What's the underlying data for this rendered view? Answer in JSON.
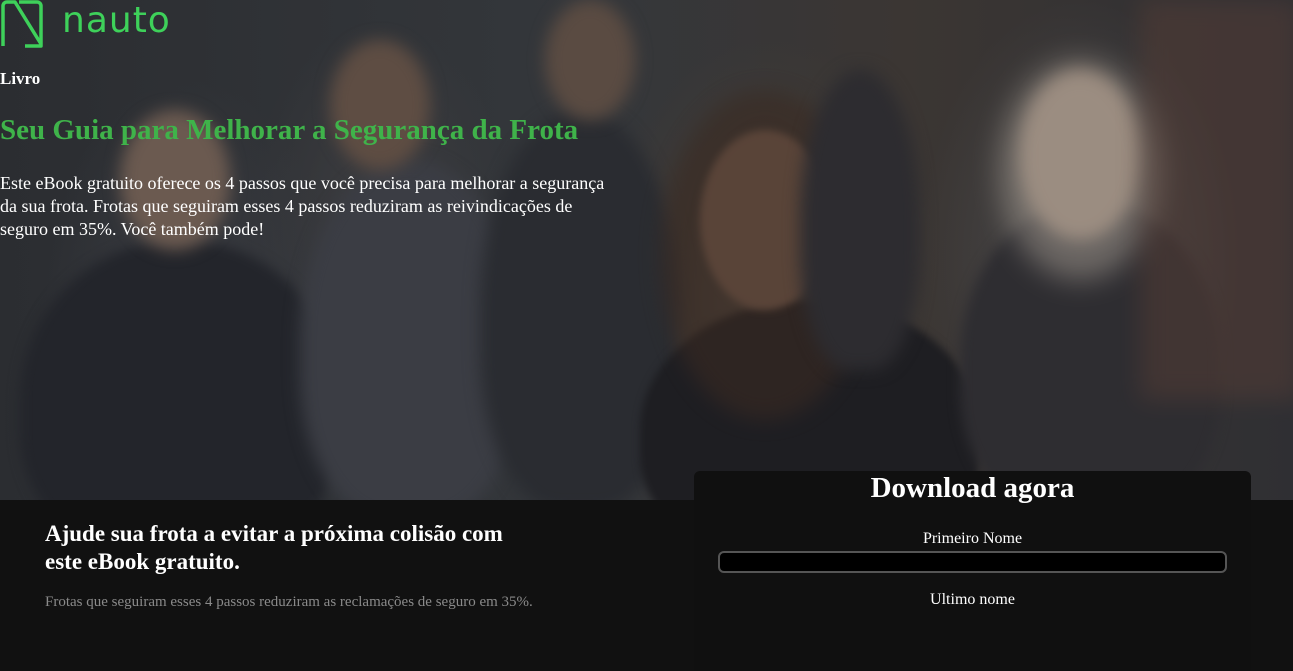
{
  "brand": {
    "logo_text": "nauto",
    "logo_color": "#3ed15a"
  },
  "hero": {
    "eyebrow": "Livro",
    "title": "Seu Guia para Melhorar a Segurança da Frota",
    "description": "Este eBook gratuito oferece os 4 passos que você precisa para melhorar a segurança da sua frota. Frotas que seguiram esses 4 passos reduziram as reivindicações de seguro em 35%. Você também pode!",
    "title_color": "#3fb34a"
  },
  "pitch": {
    "title": "Ajude sua frota a evitar a próxima colisão com este eBook gratuito.",
    "subtitle": "Frotas que seguiram esses 4 passos reduziram as reclamações de seguro em 35%."
  },
  "form": {
    "title": "Download agora",
    "first_name_label": "Primeiro Nome",
    "first_name_value": "",
    "last_name_label": "Ultimo nome"
  }
}
